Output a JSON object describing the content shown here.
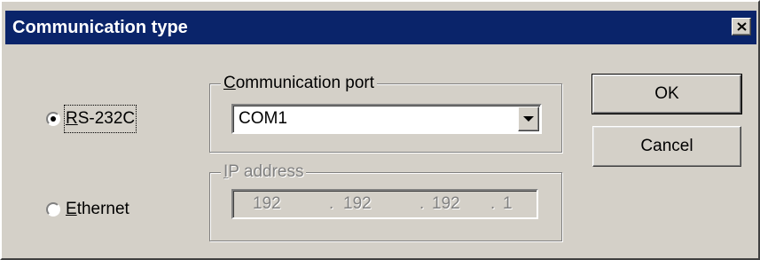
{
  "window": {
    "title": "Communication type"
  },
  "options": {
    "rs232c": {
      "label_prefix": "R",
      "label_rest": "S-232C",
      "selected": true
    },
    "ethernet": {
      "label_prefix": "E",
      "label_rest": "thernet",
      "selected": false
    }
  },
  "comm_port": {
    "legend_prefix": "C",
    "legend_rest": "ommunication port",
    "value": "COM1"
  },
  "ip_address": {
    "legend_prefix": "I",
    "legend_rest": "P address",
    "octets": [
      "192",
      "192",
      "192",
      "1"
    ]
  },
  "buttons": {
    "ok": "OK",
    "cancel": "Cancel"
  },
  "icons": {
    "close": "close-icon",
    "dropdown": "chevron-down-icon"
  }
}
